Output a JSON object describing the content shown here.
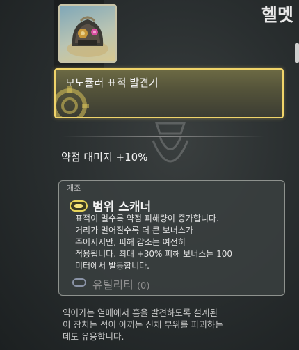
{
  "item": {
    "title": "헬멧",
    "icon": "helmet-icon"
  },
  "header": {
    "label": "모노큘러 표적 발견기",
    "emblem_icon": "gear-emblem-icon"
  },
  "stats": {
    "weak_point_damage": "약점 대미지 +10%"
  },
  "modification": {
    "section_label": "개조",
    "icon": "capsule-mod-icon",
    "name": "범위 스캐너",
    "description_lines": [
      "표적이 멀수록 약점 피해량이 증가합니다.",
      "거리가 멀어질수록 더 큰 보너스가",
      "주어지지만, 피해 감소는 여전히",
      "적용됩니다. 최대 +30% 피해 보너스는 100",
      "미터에서 발동합니다."
    ],
    "utility_label": "유틸리티",
    "utility_count": "(0)"
  },
  "lore_lines": [
    "익어가는 열매에서 흠을 발견하도록 설계된",
    "이 장치는 적이 아끼는 신체 부위를 파괴하는",
    "데도 유용합니다."
  ],
  "colors": {
    "accent_gold": "#f0d46a",
    "mod_icon_yellow": "#e5d35a",
    "utility_blue_gray": "#8a93a6"
  }
}
